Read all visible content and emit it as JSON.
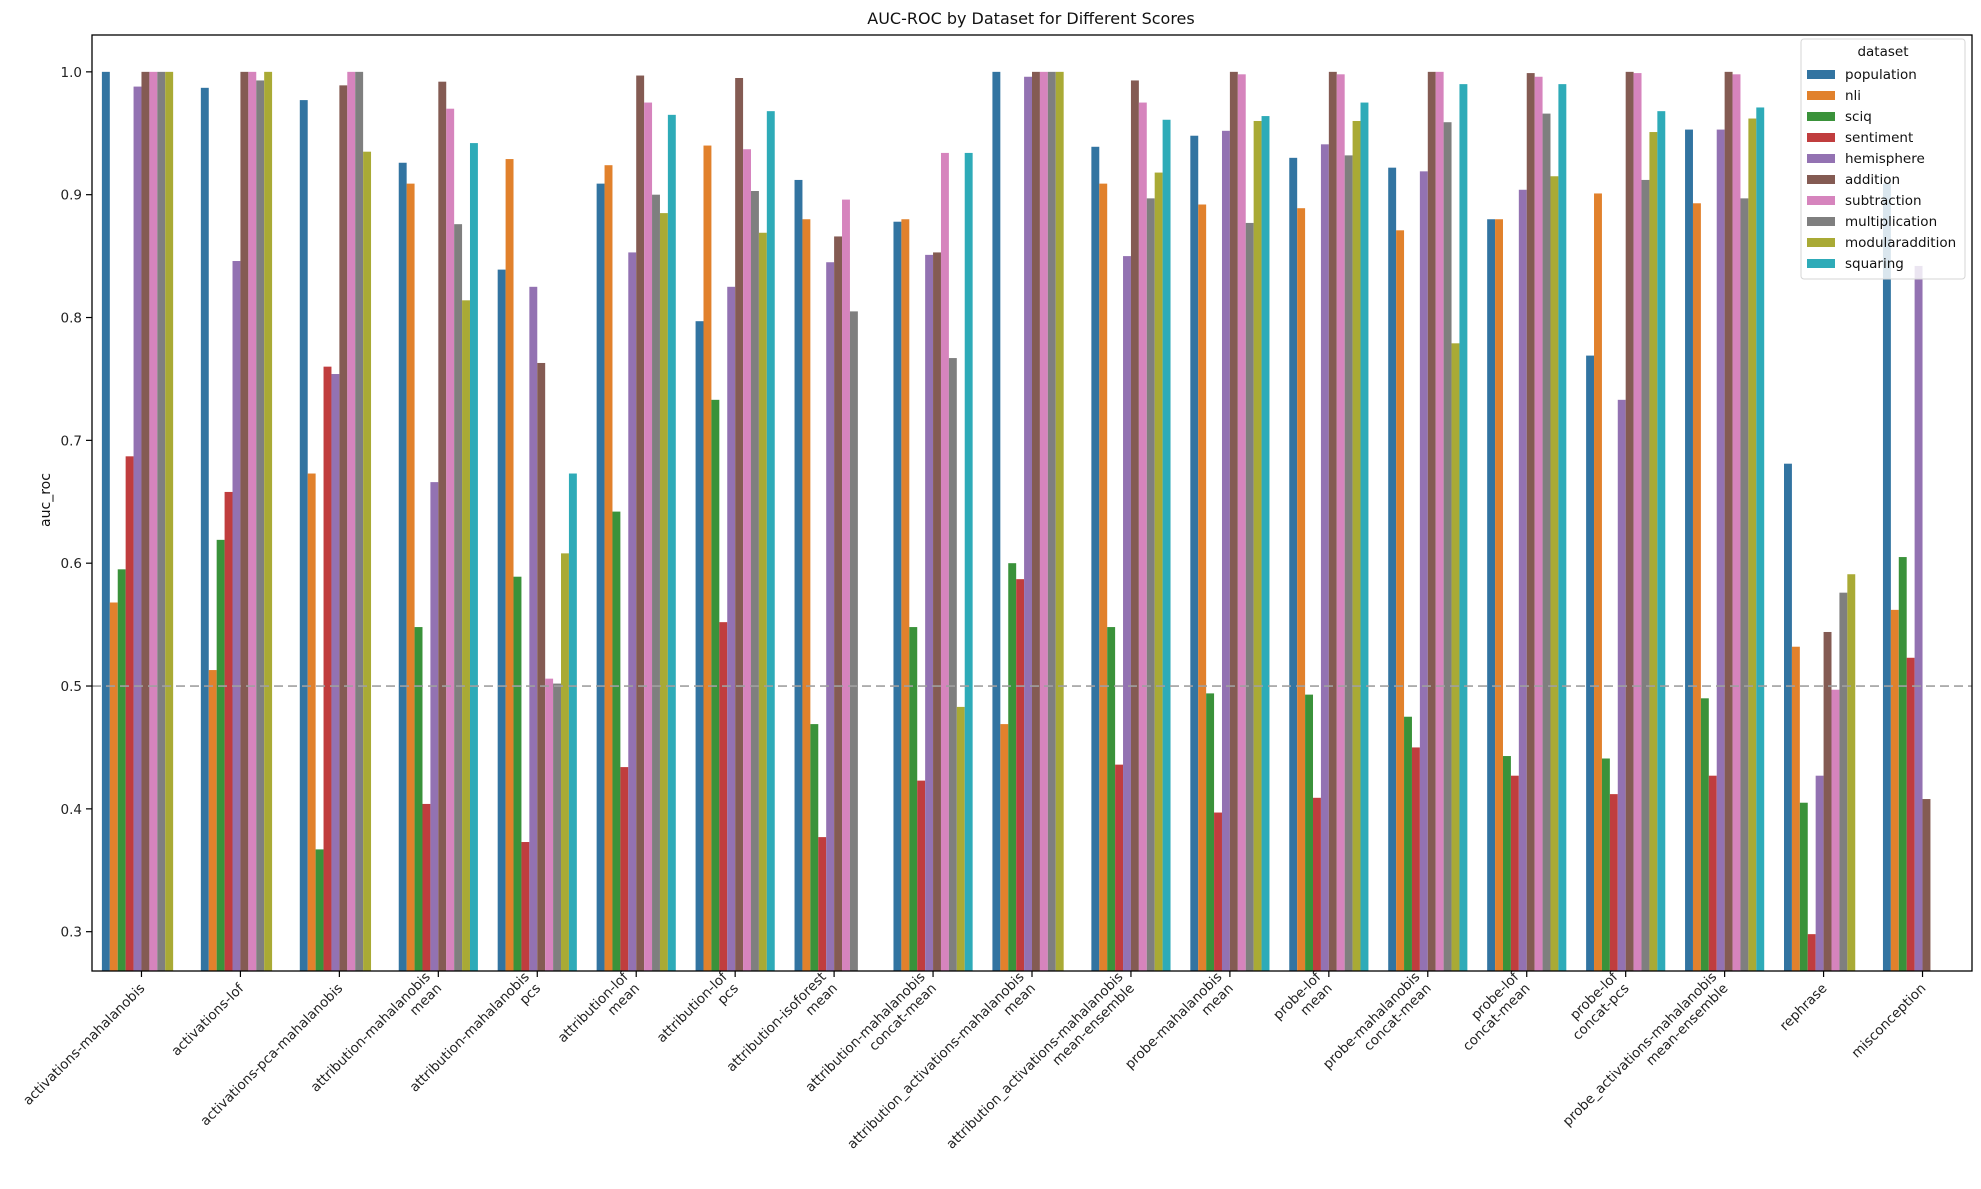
{
  "chart_data": {
    "type": "bar",
    "title": "AUC-ROC by Dataset for Different Scores",
    "xlabel": "",
    "ylabel": "auc_roc",
    "ylim": [
      0.268,
      1.03
    ],
    "yticks": [
      "0.3",
      "0.4",
      "0.5",
      "0.6",
      "0.7",
      "0.8",
      "0.9",
      "1.0"
    ],
    "ytick_values": [
      0.3,
      0.4,
      0.5,
      0.6,
      0.7,
      0.8,
      0.9,
      1.0
    ],
    "reference_line": {
      "y": 0.5,
      "style": "dashed",
      "color": "#a0a0a0"
    },
    "grid": false,
    "legend": {
      "title": "dataset",
      "placement": "top-right"
    },
    "categories": [
      [
        "activations-mahalanobis"
      ],
      [
        "activations-lof"
      ],
      [
        "activations-pca-mahalanobis"
      ],
      [
        "attribution-mahalanobis",
        "mean"
      ],
      [
        "attribution-mahalanobis",
        "pcs"
      ],
      [
        "attribution-lof",
        "mean"
      ],
      [
        "attribution-lof",
        "pcs"
      ],
      [
        "attribution-isoforest",
        "mean"
      ],
      [
        "attribution-mahalanobis",
        "concat-mean"
      ],
      [
        "attribution_activations-mahalanobis",
        "mean"
      ],
      [
        "attribution_activations-mahalanobis",
        "mean-ensemble"
      ],
      [
        "probe-mahalanobis",
        "mean"
      ],
      [
        "probe-lof",
        "mean"
      ],
      [
        "probe-mahalanobis",
        "concat-mean"
      ],
      [
        "probe-lof",
        "concat-mean"
      ],
      [
        "probe-lof",
        "concat-pcs"
      ],
      [
        "probe_activations-mahalanobis",
        "mean-ensemble"
      ],
      [
        "rephrase"
      ],
      [
        "misconception"
      ]
    ],
    "series": [
      {
        "name": "population",
        "color": "#3274a1",
        "values": [
          1.0,
          0.987,
          0.977,
          0.926,
          0.839,
          0.909,
          0.797,
          0.912,
          0.878,
          1.0,
          0.939,
          0.948,
          0.93,
          0.922,
          0.88,
          0.769,
          0.953,
          0.681,
          0.909
        ]
      },
      {
        "name": "nli",
        "color": "#e1812c",
        "values": [
          0.568,
          0.513,
          0.673,
          0.909,
          0.929,
          0.924,
          0.94,
          0.88,
          0.88,
          0.469,
          0.909,
          0.892,
          0.889,
          0.871,
          0.88,
          0.901,
          0.893,
          0.532,
          0.562
        ]
      },
      {
        "name": "sciq",
        "color": "#3a923a",
        "values": [
          0.595,
          0.619,
          0.367,
          0.548,
          0.589,
          0.642,
          0.733,
          0.469,
          0.548,
          0.6,
          0.548,
          0.494,
          0.493,
          0.475,
          0.443,
          0.441,
          0.49,
          0.405,
          0.605
        ]
      },
      {
        "name": "sentiment",
        "color": "#c03d3e",
        "values": [
          0.687,
          0.658,
          0.76,
          0.404,
          0.373,
          0.434,
          0.552,
          0.377,
          0.423,
          0.587,
          0.436,
          0.397,
          0.409,
          0.45,
          0.427,
          0.412,
          0.427,
          0.298,
          0.523
        ]
      },
      {
        "name": "hemisphere",
        "color": "#9372b2",
        "values": [
          0.988,
          0.846,
          0.754,
          0.666,
          0.825,
          0.853,
          0.825,
          0.845,
          0.851,
          0.996,
          0.85,
          0.952,
          0.941,
          0.919,
          0.904,
          0.733,
          0.953,
          0.427,
          0.842
        ]
      },
      {
        "name": "addition",
        "color": "#845b53",
        "values": [
          1.0,
          1.0,
          0.989,
          0.992,
          0.763,
          0.997,
          0.995,
          0.866,
          0.853,
          1.0,
          0.993,
          1.0,
          1.0,
          1.0,
          0.999,
          1.0,
          1.0,
          0.544,
          0.408
        ]
      },
      {
        "name": "subtraction",
        "color": "#d684bd",
        "values": [
          1.0,
          1.0,
          1.0,
          0.97,
          0.506,
          0.975,
          0.937,
          0.896,
          0.934,
          1.0,
          0.975,
          0.998,
          0.998,
          1.0,
          0.996,
          0.999,
          0.998,
          0.497,
          null
        ]
      },
      {
        "name": "multiplication",
        "color": "#7f7f7f",
        "values": [
          1.0,
          0.993,
          1.0,
          0.876,
          0.502,
          0.9,
          0.903,
          0.805,
          0.767,
          1.0,
          0.897,
          0.877,
          0.932,
          0.959,
          0.966,
          0.912,
          0.897,
          0.576,
          null
        ]
      },
      {
        "name": "modularaddition",
        "color": "#a9aa35",
        "values": [
          1.0,
          1.0,
          0.935,
          0.814,
          0.608,
          0.885,
          0.869,
          null,
          0.483,
          1.0,
          0.918,
          0.96,
          0.96,
          0.779,
          0.915,
          0.951,
          0.962,
          0.591,
          null
        ]
      },
      {
        "name": "squaring",
        "color": "#2eabb8",
        "values": [
          null,
          null,
          null,
          0.942,
          0.673,
          0.965,
          0.968,
          null,
          0.934,
          null,
          0.961,
          0.964,
          0.975,
          0.99,
          0.99,
          0.968,
          0.971,
          null,
          null
        ]
      }
    ]
  }
}
